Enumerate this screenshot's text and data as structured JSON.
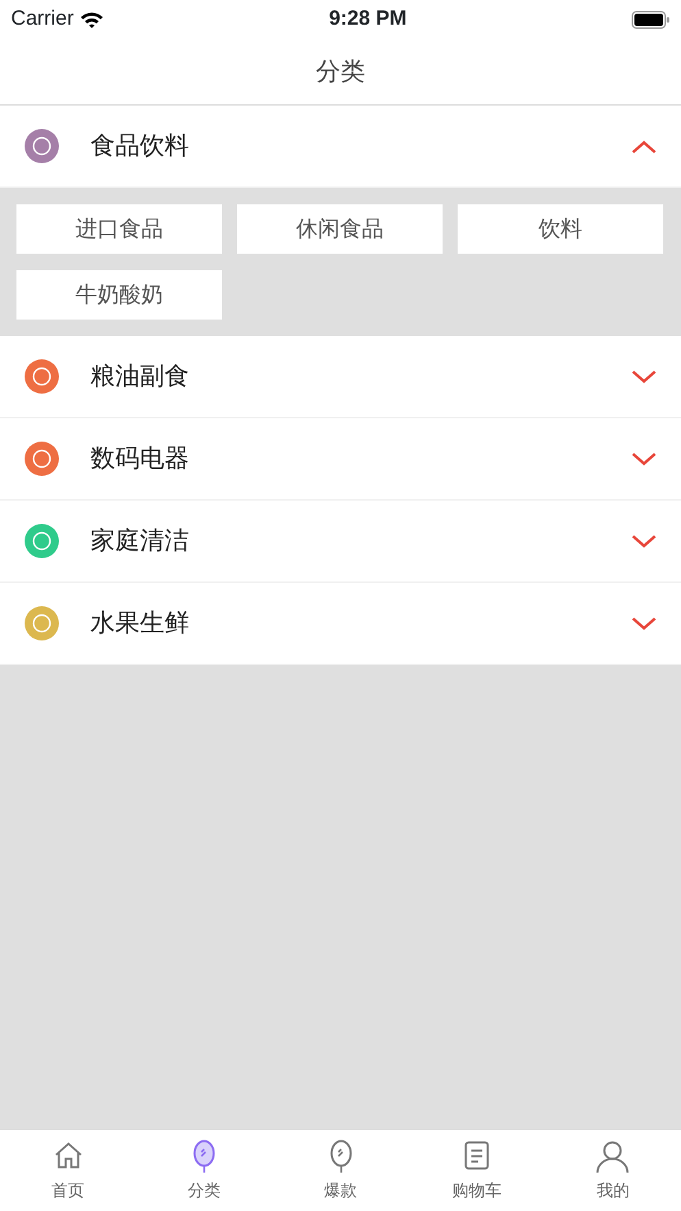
{
  "status_bar": {
    "carrier": "Carrier",
    "time": "9:28 PM"
  },
  "nav": {
    "title": "分类"
  },
  "categories": [
    {
      "name": "食品饮料",
      "color": "#a57fa8",
      "expanded": true,
      "subcategories": [
        "进口食品",
        "休闲食品",
        "饮料",
        "牛奶酸奶"
      ]
    },
    {
      "name": "粮油副食",
      "color": "#ee6e43",
      "expanded": false
    },
    {
      "name": "数码电器",
      "color": "#ee6e43",
      "expanded": false
    },
    {
      "name": "家庭清洁",
      "color": "#2fcb8b",
      "expanded": false
    },
    {
      "name": "水果生鲜",
      "color": "#dcb84f",
      "expanded": false
    }
  ],
  "tab_bar": [
    {
      "label": "首页",
      "kind": "home",
      "selected": false
    },
    {
      "label": "分类",
      "kind": "category",
      "selected": true
    },
    {
      "label": "爆款",
      "kind": "hot",
      "selected": false
    },
    {
      "label": "购物车",
      "kind": "cart",
      "selected": false
    },
    {
      "label": "我的",
      "kind": "profile",
      "selected": false
    }
  ]
}
